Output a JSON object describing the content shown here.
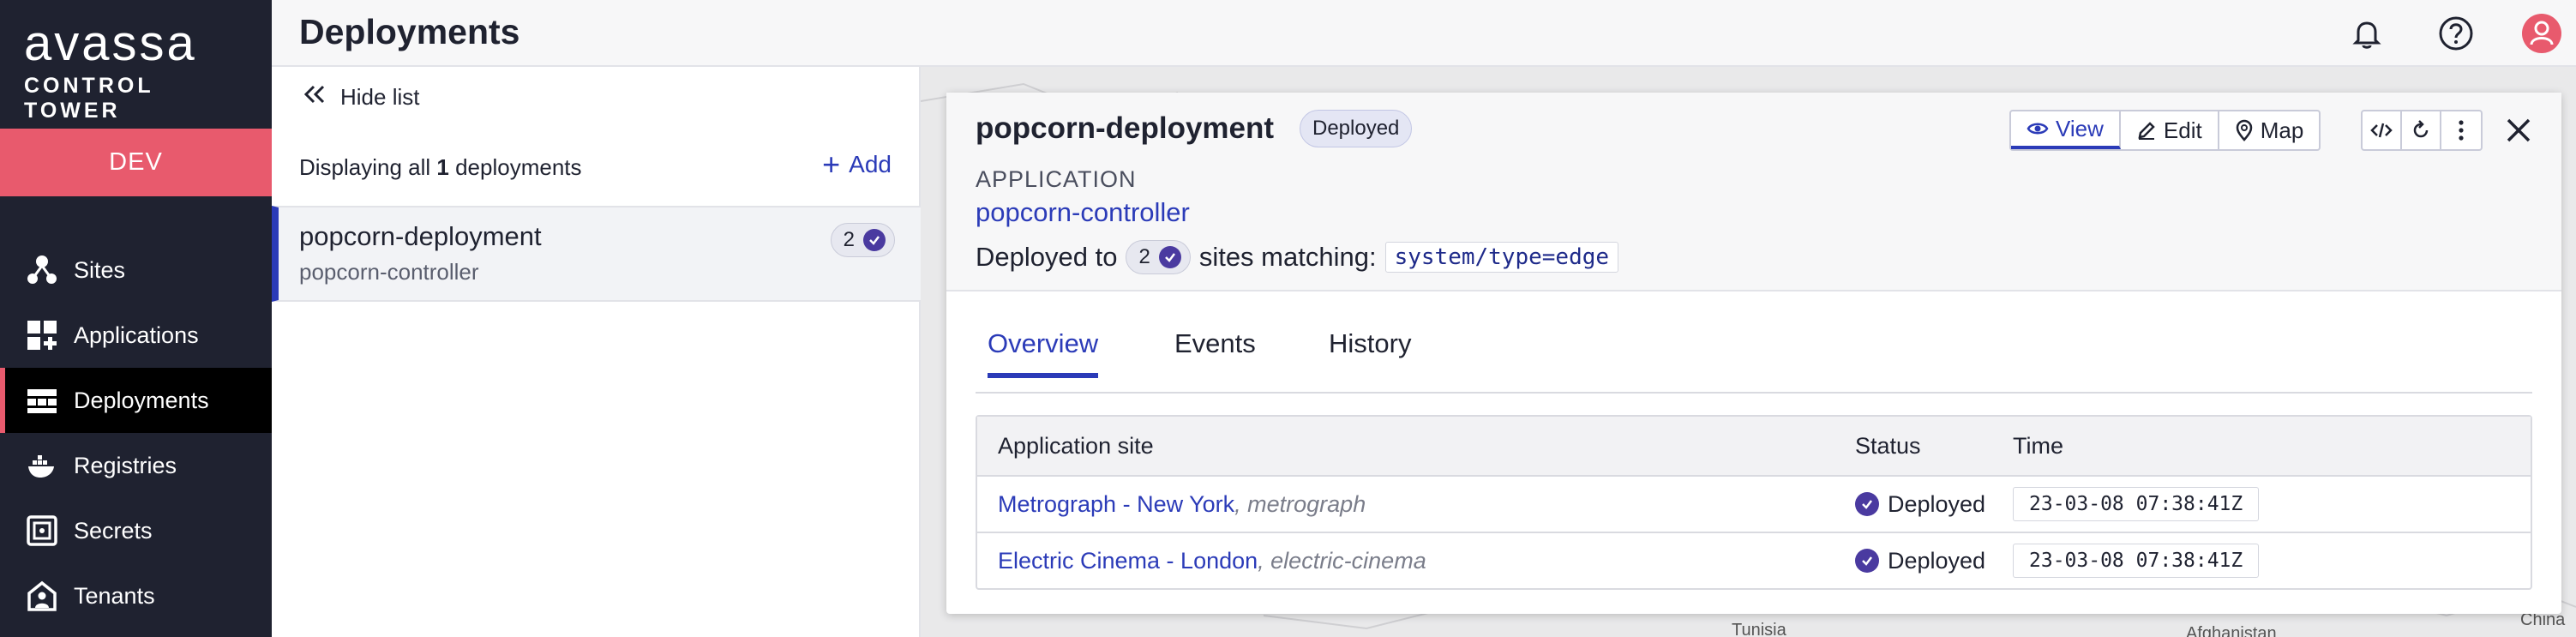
{
  "brand": {
    "name": "avassa",
    "tagline": "CONTROL TOWER",
    "environment": "DEV"
  },
  "nav": [
    {
      "label": "Sites",
      "icon": "sites-icon"
    },
    {
      "label": "Applications",
      "icon": "applications-icon"
    },
    {
      "label": "Deployments",
      "icon": "deployments-icon",
      "active": true
    },
    {
      "label": "Registries",
      "icon": "registries-icon"
    },
    {
      "label": "Secrets",
      "icon": "secrets-icon"
    },
    {
      "label": "Tenants",
      "icon": "tenants-icon"
    }
  ],
  "header": {
    "title": "Deployments",
    "icons": [
      "notifications-bell-icon",
      "help-icon",
      "user-avatar-icon"
    ]
  },
  "list": {
    "hide_label": "Hide list",
    "summary_prefix": "Displaying all ",
    "summary_count": "1",
    "summary_suffix": " deployments",
    "add_label": "Add",
    "items": [
      {
        "name": "popcorn-deployment",
        "application": "popcorn-controller",
        "site_count": "2"
      }
    ]
  },
  "detail": {
    "name": "popcorn-deployment",
    "status_badge": "Deployed",
    "kind_label": "APPLICATION",
    "application": "popcorn-controller",
    "deployed_prefix": "Deployed to",
    "site_count": "2",
    "deployed_suffix": "sites matching:",
    "match_expression": "system/type=edge",
    "actions": {
      "view": "View",
      "edit": "Edit",
      "map": "Map"
    },
    "tabs": [
      {
        "label": "Overview",
        "active": true
      },
      {
        "label": "Events"
      },
      {
        "label": "History"
      }
    ],
    "table": {
      "headers": {
        "site": "Application site",
        "status": "Status",
        "time": "Time"
      },
      "rows": [
        {
          "site": "Metrograph - New York",
          "alias": ", metrograph",
          "status": "Deployed",
          "time": "23-03-08 07:38:41Z"
        },
        {
          "site": "Electric Cinema - London",
          "alias": ", electric-cinema",
          "status": "Deployed",
          "time": "23-03-08 07:38:41Z"
        }
      ]
    }
  },
  "map": {
    "labels": [
      "Tunisia",
      "Afghanistan",
      "China"
    ]
  },
  "colors": {
    "sidebar": "#1f2230",
    "accent": "#2b3bb8",
    "env": "#e85a6d",
    "check": "#4a3aa0"
  }
}
